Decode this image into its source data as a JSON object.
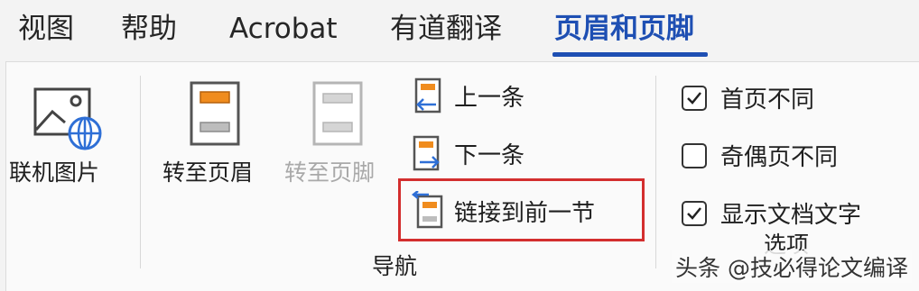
{
  "tabs": [
    {
      "label": "视图",
      "active": false
    },
    {
      "label": "帮助",
      "active": false
    },
    {
      "label": "Acrobat",
      "active": false
    },
    {
      "label": "有道翻译",
      "active": false
    },
    {
      "label": "页眉和页脚",
      "active": true
    }
  ],
  "insert_group": {
    "online_pictures_label": "联机图片",
    "icon": "online-picture-icon"
  },
  "navigation_group": {
    "label": "导航",
    "goto_header_label": "转至页眉",
    "goto_footer_label": "转至页脚",
    "goto_footer_disabled": true,
    "previous_label": "上一条",
    "next_label": "下一条",
    "link_to_previous_label": "链接到前一节",
    "link_to_previous_highlighted": true
  },
  "options_group": {
    "label": "选项",
    "different_first_page": {
      "label": "首页不同",
      "checked": true
    },
    "different_odd_even": {
      "label": "奇偶页不同",
      "checked": false
    },
    "show_document_text": {
      "label": "显示文档文字",
      "checked": true
    }
  },
  "watermark": "头条 @技必得论文编译",
  "colors": {
    "accent": "#1e4fb3",
    "header_orange": "#f08c1e",
    "highlight_red": "#d32e2e",
    "arrow_blue": "#2e6fd6"
  }
}
